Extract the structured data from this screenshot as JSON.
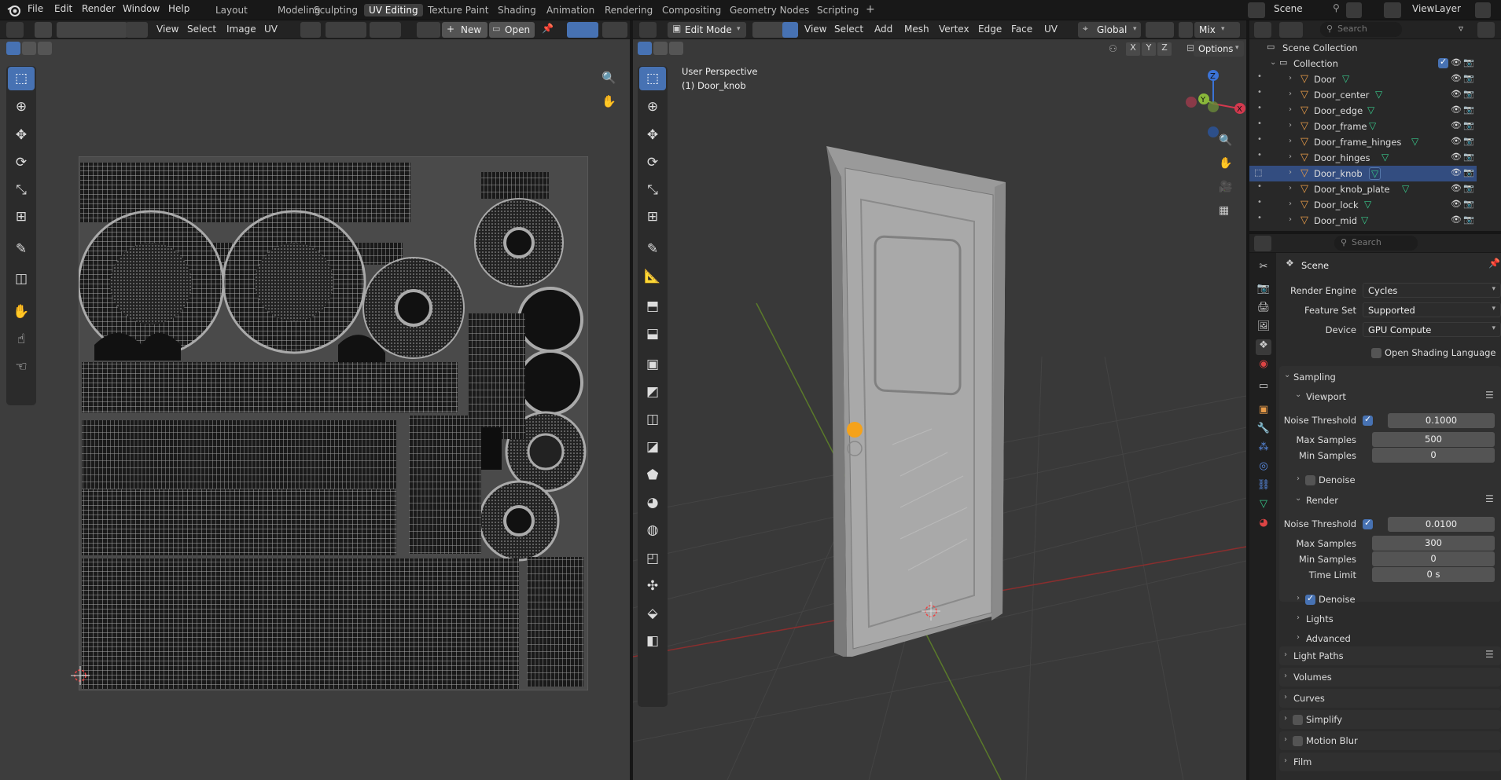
{
  "topbar": {
    "menus": [
      "File",
      "Edit",
      "Render",
      "Window",
      "Help"
    ],
    "workspaces": [
      "Layout",
      "Modeling",
      "Sculpting",
      "UV Editing",
      "Texture Paint",
      "Shading",
      "Animation",
      "Rendering",
      "Compositing",
      "Geometry Nodes",
      "Scripting"
    ],
    "active_workspace": "UV Editing",
    "add_workspace": "+",
    "scene_label": "Scene",
    "viewlayer_label": "ViewLayer"
  },
  "uv_editor": {
    "menus": [
      "View",
      "Select",
      "Image",
      "UV"
    ],
    "new_label": "New",
    "open_label": "Open"
  },
  "viewport": {
    "mode_label": "Edit Mode",
    "menus": [
      "View",
      "Select",
      "Add",
      "Mesh",
      "Vertex",
      "Edge",
      "Face",
      "UV"
    ],
    "transform_orientation": "Global",
    "shading_label": "Mix",
    "options_label": "Options",
    "axis_labels": [
      "X",
      "Y",
      "Z"
    ],
    "perspective_label": "User Perspective",
    "active_object_label": "(1) Door_knob"
  },
  "outliner": {
    "search_placeholder": "Search",
    "scene_collection": "Scene Collection",
    "collection": "Collection",
    "items": [
      {
        "name": "Door"
      },
      {
        "name": "Door_center"
      },
      {
        "name": "Door_edge"
      },
      {
        "name": "Door_frame"
      },
      {
        "name": "Door_frame_hinges"
      },
      {
        "name": "Door_hinges"
      },
      {
        "name": "Door_knob"
      },
      {
        "name": "Door_knob_plate"
      },
      {
        "name": "Door_lock"
      },
      {
        "name": "Door_mid"
      }
    ],
    "selected_item": "Door_knob"
  },
  "properties": {
    "search_placeholder": "Search",
    "context_title": "Scene",
    "render_engine_label": "Render Engine",
    "render_engine_value": "Cycles",
    "feature_set_label": "Feature Set",
    "feature_set_value": "Supported",
    "device_label": "Device",
    "device_value": "GPU Compute",
    "osl_label": "Open Shading Language",
    "sampling": "Sampling",
    "viewport": "Viewport",
    "viewport_noise_threshold_label": "Noise Threshold",
    "viewport_noise_threshold": "0.1000",
    "viewport_max_samples_label": "Max Samples",
    "viewport_max_samples": "500",
    "viewport_min_samples_label": "Min Samples",
    "viewport_min_samples": "0",
    "viewport_denoise": "Denoise",
    "render": "Render",
    "render_noise_threshold_label": "Noise Threshold",
    "render_noise_threshold": "0.0100",
    "render_max_samples_label": "Max Samples",
    "render_max_samples": "300",
    "render_min_samples_label": "Min Samples",
    "render_min_samples": "0",
    "time_limit_label": "Time Limit",
    "time_limit": "0 s",
    "render_denoise": "Denoise",
    "lights": "Lights",
    "advanced": "Advanced",
    "light_paths": "Light Paths",
    "volumes": "Volumes",
    "curves": "Curves",
    "simplify": "Simplify",
    "motion_blur": "Motion Blur",
    "film": "Film"
  },
  "colors": {
    "accent": "#4772b3",
    "selected_row": "#334d80",
    "object_icon": "#e69a48",
    "mesh_icon": "#38c98b",
    "knob": "#f5a21a"
  }
}
